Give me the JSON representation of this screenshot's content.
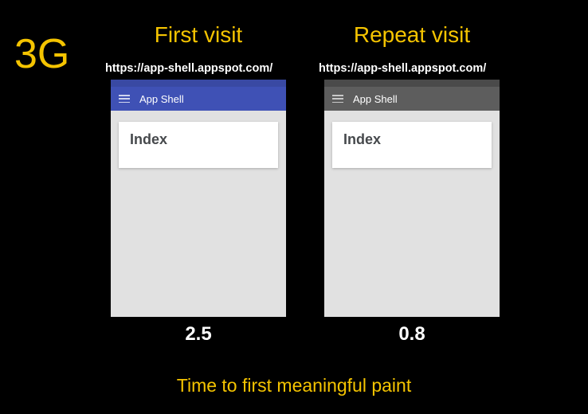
{
  "network_label": "3G",
  "caption": "Time to first meaningful paint",
  "first": {
    "title": "First visit",
    "url": "https://app-shell.appspot.com/",
    "app_title": "App Shell",
    "card_title": "Index",
    "timing": "2.5"
  },
  "repeat": {
    "title": "Repeat visit",
    "url": "https://app-shell.appspot.com/",
    "app_title": "App Shell",
    "card_title": "Index",
    "timing": "0.8"
  }
}
